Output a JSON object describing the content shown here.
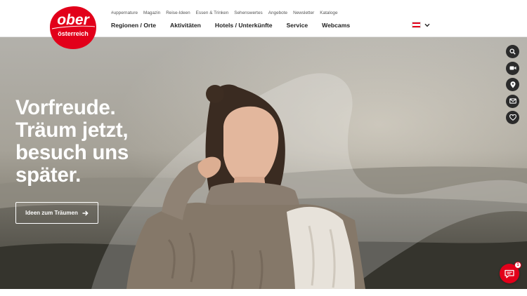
{
  "brand": {
    "logo_line1": "ober",
    "logo_line2": "österreich",
    "color": "#e2001a"
  },
  "topnav": {
    "items": [
      "#uppernature",
      "Magazin",
      "Reise-Ideen",
      "Essen & Trinken",
      "Sehenswertes",
      "Angebote",
      "Newsletter",
      "Kataloge"
    ]
  },
  "mainnav": {
    "items": [
      "Regionen / Orte",
      "Aktivitäten",
      "Hotels / Unterkünfte",
      "Service",
      "Webcams"
    ]
  },
  "language": {
    "flag_icon": "austria-flag-icon",
    "chevron_icon": "chevron-down-icon"
  },
  "hero": {
    "title_lines": [
      "Vorfreude.",
      "Träum jetzt,",
      "besuch uns",
      "später."
    ],
    "cta_label": "Ideen zum Träumen",
    "cta_icon": "arrow-right-icon"
  },
  "side_actions": [
    "search-icon",
    "video-icon",
    "location-pin-icon",
    "mail-icon",
    "heart-icon"
  ],
  "chat": {
    "icon": "chat-icon",
    "badge": "1"
  }
}
